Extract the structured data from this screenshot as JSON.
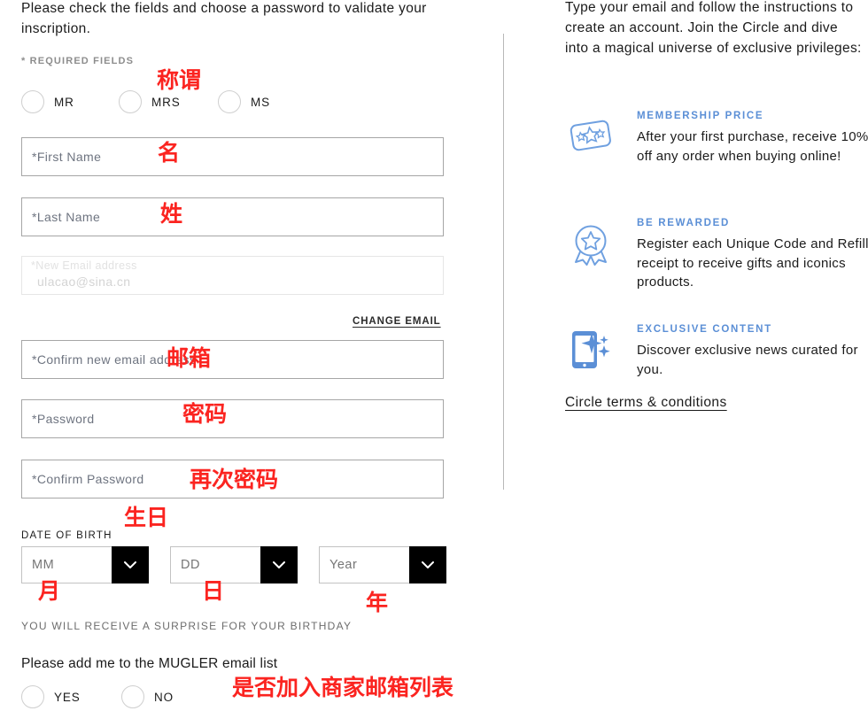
{
  "left": {
    "intro": "Please check the fields and choose a password to validate your inscription.",
    "required_note": "* REQUIRED FIELDS",
    "title_radios": [
      {
        "label": "MR",
        "selected": false
      },
      {
        "label": "MRS",
        "selected": false
      },
      {
        "label": "MS",
        "selected": false
      }
    ],
    "fields": {
      "first_name": {
        "placeholder": "*First Name",
        "value": ""
      },
      "last_name": {
        "placeholder": "*Last Name",
        "value": ""
      },
      "new_email": {
        "label": "*New Email address",
        "value": "ulacao@sina.cn",
        "disabled": true
      },
      "confirm_email": {
        "placeholder": "*Confirm new email address",
        "value": ""
      },
      "password": {
        "placeholder": "*Password",
        "value": ""
      },
      "confirm_password": {
        "placeholder": "*Confirm Password",
        "value": ""
      }
    },
    "change_email_link": "CHANGE EMAIL",
    "dob": {
      "label": "DATE OF BIRTH",
      "month": {
        "selected": "MM"
      },
      "day": {
        "selected": "DD"
      },
      "year": {
        "selected": "Year"
      },
      "note": "YOU WILL RECEIVE A SURPRISE FOR YOUR BIRTHDAY"
    },
    "newsletter": {
      "title": "Please add me to the MUGLER email list",
      "options": [
        {
          "label": "YES",
          "selected": false
        },
        {
          "label": "NO",
          "selected": false
        }
      ]
    }
  },
  "annotations": [
    {
      "text": "称谓",
      "for": "title-radios"
    },
    {
      "text": "名",
      "for": "first-name"
    },
    {
      "text": "姓",
      "for": "last-name"
    },
    {
      "text": "邮箱",
      "for": "confirm-email"
    },
    {
      "text": "密码",
      "for": "password"
    },
    {
      "text": "再次密码",
      "for": "confirm-password"
    },
    {
      "text": "生日",
      "for": "date-of-birth"
    },
    {
      "text": "月",
      "for": "dob-month"
    },
    {
      "text": "日",
      "for": "dob-day"
    },
    {
      "text": "年",
      "for": "dob-year"
    },
    {
      "text": "是否加入商家邮箱列表",
      "for": "newsletter"
    }
  ],
  "right": {
    "intro": "Type your email and follow the instructions to create an account. Join the Circle and dive into a magical universe of exclusive privileges:",
    "benefits": [
      {
        "icon": "ticket-stars-icon",
        "title": "MEMBERSHIP PRICE",
        "desc": "After your first purchase, receive 10% off any order when buying online!"
      },
      {
        "icon": "award-badge-icon",
        "title": "BE REWARDED",
        "desc": "Register each Unique Code and Refill receipt to receive gifts and iconics products."
      },
      {
        "icon": "phone-sparkle-icon",
        "title": "EXCLUSIVE CONTENT",
        "desc": "Discover exclusive news curated for you."
      }
    ],
    "terms_link": "Circle terms & conditions"
  },
  "colors": {
    "accent_blue": "#5b8fd6",
    "annotation_red": "#fb2420",
    "text": "#1b1b1b",
    "muted": "#8d8d8d",
    "field_border": "#a6a6a6",
    "disabled_border": "#e6e6e6",
    "dropdown_arrow_bg": "#000000"
  }
}
